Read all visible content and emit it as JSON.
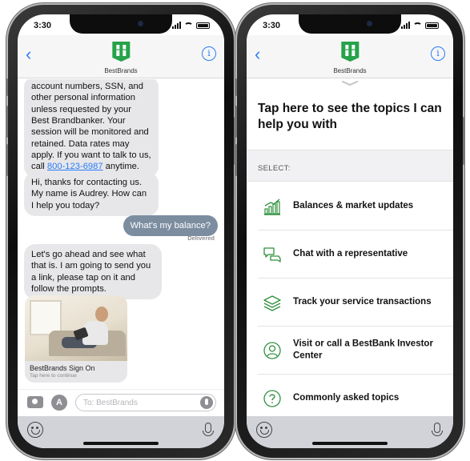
{
  "colors": {
    "accent": "#2a7cf6",
    "brand_green": "#26a34a",
    "outgoing_bubble": "#7c8da0",
    "incoming_bubble": "#e7e7ea",
    "icon_green": "#2f8f3d"
  },
  "left_phone": {
    "status": {
      "time": "3:30"
    },
    "nav": {
      "brand": "BestBrands",
      "back_icon": "chevron-left-icon",
      "info_icon": "info-icon",
      "info_glyph": "i"
    },
    "messages": {
      "m1_text": "account numbers, SSN, and other personal information unless requested by your Best Brandbanker. Your session will be monitored and retained. Data rates may apply. If you want to talk to us, call",
      "m1_phone": "800-123-6987",
      "m1_after": " anytime.",
      "m2": "Hi, thanks for contacting us. My name is Audrey. How can I help you today?",
      "m3": "What's my balance?",
      "delivered": "Delivered",
      "m4": "Let's go ahead and see what that is. I am going to send you a link, please tap on it and follow the prompts.",
      "card_title": "BestBrands Sign On",
      "card_subtitle": "Tap here to continue"
    },
    "composer": {
      "placeholder": "To: BestBrands",
      "apps_glyph": "A"
    }
  },
  "right_phone": {
    "status": {
      "time": "3:30"
    },
    "nav": {
      "brand": "BestBrands",
      "info_glyph": "i"
    },
    "title": "Tap here to see the topics I can help you with",
    "select_label": "SELECT:",
    "topics": [
      {
        "label": "Balances & market updates",
        "icon": "bar-chart-icon"
      },
      {
        "label": "Chat with a representative",
        "icon": "chat-bubbles-icon"
      },
      {
        "label": "Track your service transactions",
        "icon": "layers-icon"
      },
      {
        "label": "Visit or call a BestBank Investor Center",
        "icon": "person-circle-icon"
      },
      {
        "label": "Commonly asked topics",
        "icon": "question-circle-icon"
      }
    ]
  }
}
